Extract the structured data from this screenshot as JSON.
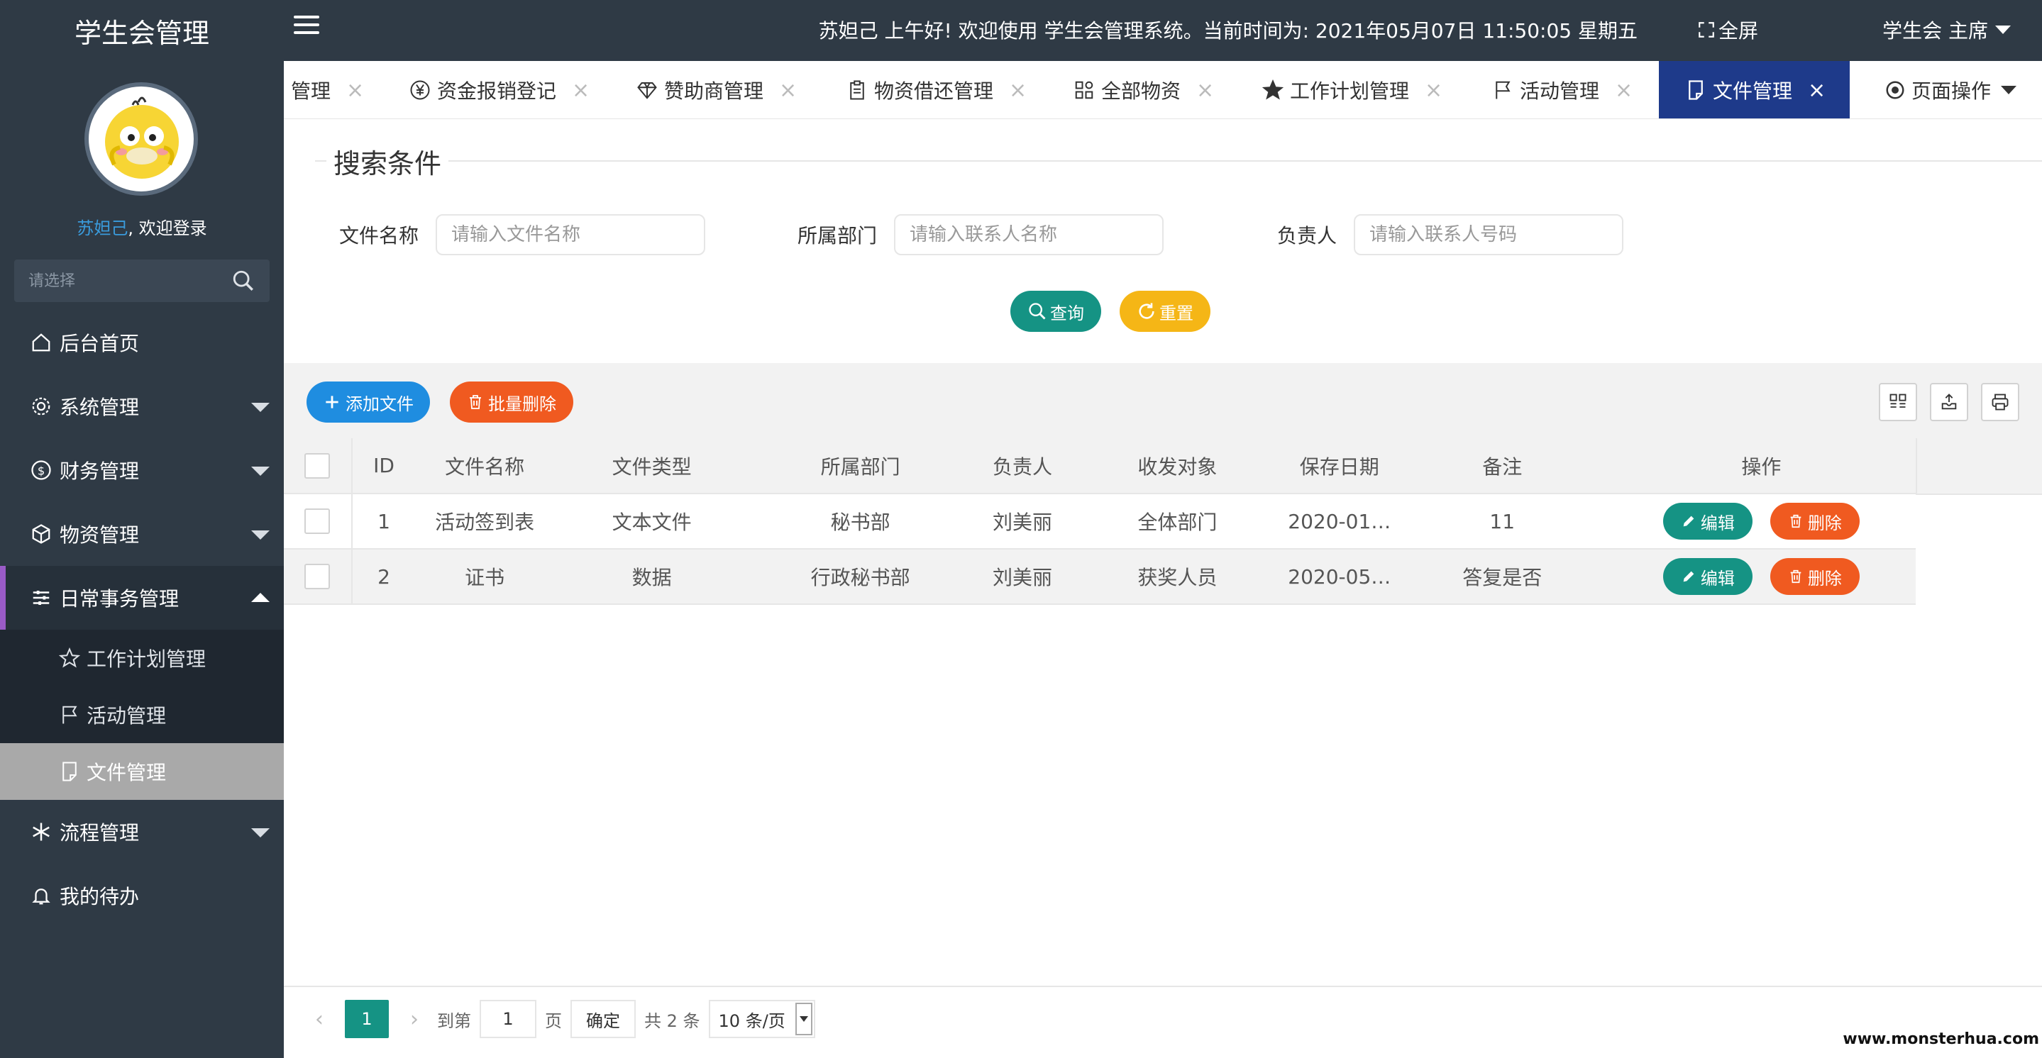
{
  "sidebar": {
    "title": "学生会管理",
    "user_name": "苏妲己",
    "welcome_suffix": ", 欢迎登录",
    "search_placeholder": "请选择",
    "menu": [
      {
        "label": "后台首页",
        "icon": "home-icon"
      },
      {
        "label": "系统管理",
        "icon": "gear-icon"
      },
      {
        "label": "财务管理",
        "icon": "dollar-icon"
      },
      {
        "label": "物资管理",
        "icon": "cube-icon"
      },
      {
        "label": "日常事务管理",
        "icon": "sliders-icon"
      },
      {
        "label": "流程管理",
        "icon": "snowflake-icon"
      },
      {
        "label": "我的待办",
        "icon": "bell-icon"
      }
    ],
    "submenu": [
      {
        "label": "工作计划管理",
        "icon": "star-icon"
      },
      {
        "label": "活动管理",
        "icon": "flag-icon"
      },
      {
        "label": "文件管理",
        "icon": "file-icon"
      }
    ]
  },
  "header": {
    "greeting": "苏妲己 上午好!  欢迎使用 学生会管理系统。当前时间为:  2021年05月07日 11:50:05    星期五",
    "fullscreen": "全屏",
    "user_role": "学生会 主席"
  },
  "tabs": [
    {
      "label": "管理",
      "icon": ""
    },
    {
      "label": "资金报销登记",
      "icon": "yen-icon"
    },
    {
      "label": "赞助商管理",
      "icon": "diamond-icon"
    },
    {
      "label": "物资借还管理",
      "icon": "clipboard-icon"
    },
    {
      "label": "全部物资",
      "icon": "grid-icon"
    },
    {
      "label": "工作计划管理",
      "icon": "star-icon"
    },
    {
      "label": "活动管理",
      "icon": "flag-icon"
    },
    {
      "label": "文件管理",
      "icon": "file-icon"
    }
  ],
  "tab_close": "×",
  "page_ops": "页面操作",
  "search": {
    "legend": "搜索条件",
    "fields": [
      {
        "label": "文件名称",
        "placeholder": "请输入文件名称"
      },
      {
        "label": "所属部门",
        "placeholder": "请输入联系人名称"
      },
      {
        "label": "负责人",
        "placeholder": "请输入联系人号码"
      }
    ],
    "query_label": "查询",
    "reset_label": "重置"
  },
  "toolbar": {
    "add_label": "添加文件",
    "batch_delete_label": "批量删除"
  },
  "table": {
    "columns": [
      "ID",
      "文件名称",
      "文件类型",
      "所属部门",
      "负责人",
      "收发对象",
      "保存日期",
      "备注",
      "操作"
    ],
    "rows": [
      [
        "1",
        "活动签到表",
        "文本文件",
        "秘书部",
        "刘美丽",
        "全体部门",
        "2020-01…",
        "11"
      ],
      [
        "2",
        "证书",
        "数据",
        "行政秘书部",
        "刘美丽",
        "获奖人员",
        "2020-05…",
        "答复是否"
      ]
    ],
    "edit_label": "编辑",
    "delete_label": "删除"
  },
  "pagination": {
    "prev": "‹",
    "next": "›",
    "current": "1",
    "goto_label": "到第",
    "page_input": "1",
    "page_unit": "页",
    "confirm": "确定",
    "total": "共 2 条",
    "page_size": "10 条/页"
  },
  "watermark": "www.monsterhua.com",
  "colors": {
    "sidebar_bg": "#2f3a45",
    "active_tab": "#1e3a8a",
    "primary_green": "#159384",
    "warning_yellow": "#f5b616",
    "danger_orange": "#f05a20",
    "add_blue": "#1f8de0"
  }
}
